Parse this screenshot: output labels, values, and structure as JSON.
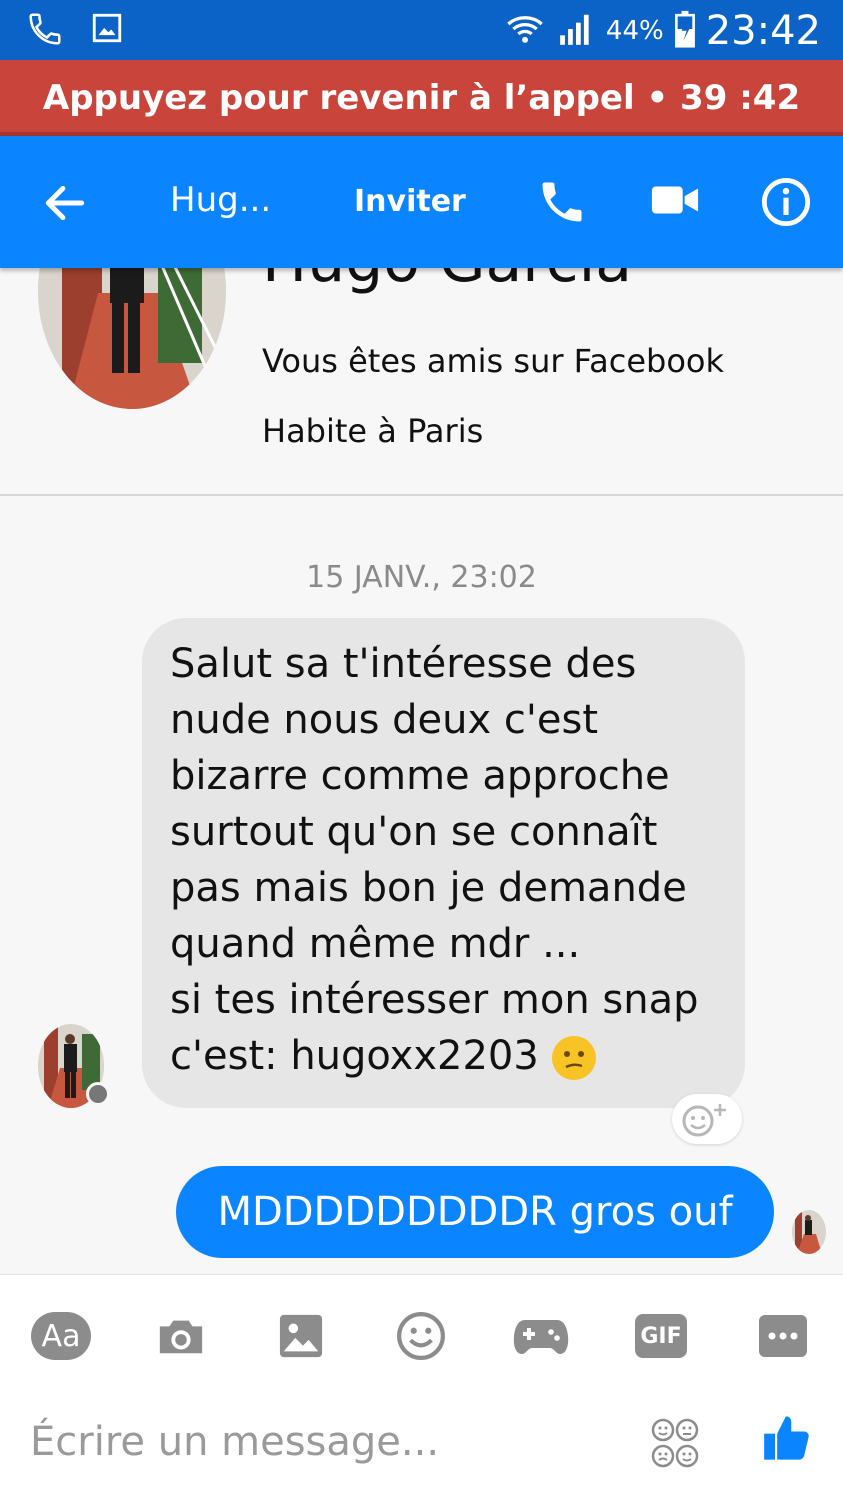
{
  "status_bar": {
    "battery": "44%",
    "time": "23:42"
  },
  "call_banner": {
    "text": "Appuyez pour revenir à l’appel • 39 :42"
  },
  "nav": {
    "name": "Hug...",
    "invite": "Inviter"
  },
  "profile": {
    "name": "Hugo Garcia",
    "friends": "Vous êtes amis sur Facebook",
    "city": "Habite à Paris"
  },
  "conversation": {
    "timestamp": "15 JANV., 23:02",
    "incoming_lines": [
      "Salut sa t'intéresse des",
      "nude nous deux c'est",
      "bizarre comme approche",
      "surtout qu'on se connaît",
      "pas mais bon je demande",
      "quand même mdr ...",
      "si tes intéresser mon snap",
      "c'est: hugoxx2203"
    ],
    "outgoing": "MDDDDDDDDDR gros ouf"
  },
  "composer": {
    "aa_label": "Aa",
    "gif_label": "GIF",
    "placeholder": "Écrire un message..."
  },
  "colors": {
    "status_bar": "#0b63c8",
    "call_banner": "#c9453b",
    "nav": "#0a84ff",
    "outgoing_bubble": "#0a84ff",
    "incoming_bubble": "#e6e6e6"
  }
}
